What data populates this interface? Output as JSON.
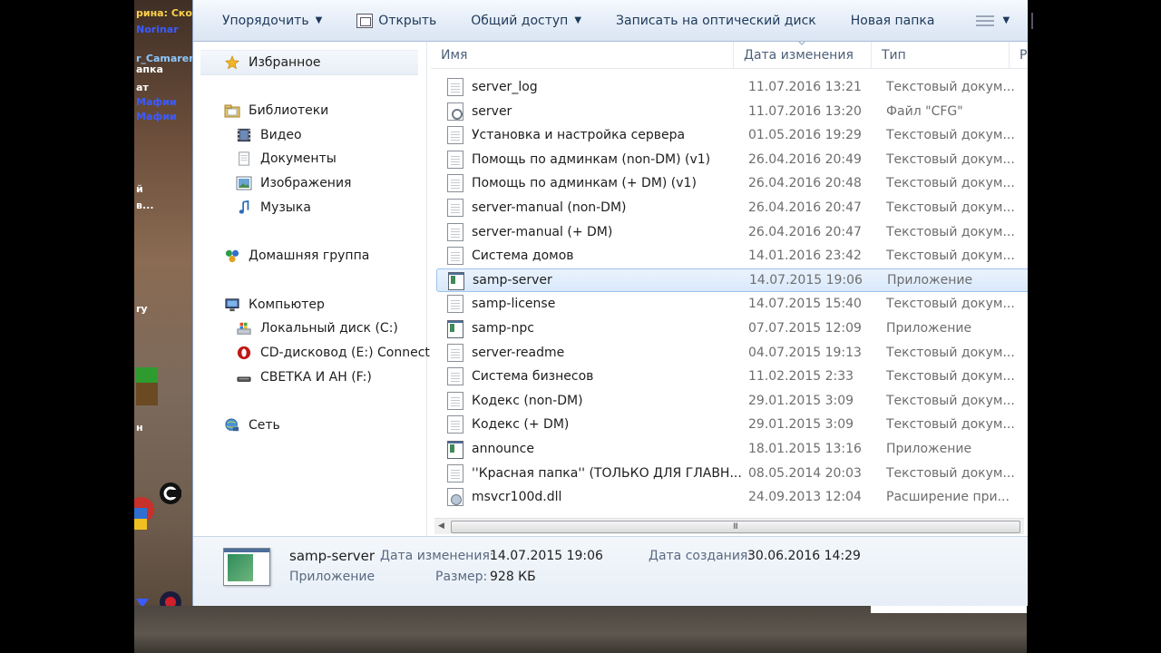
{
  "game_chat": [
    "рина: Ско",
    "Norinar",
    "r_Camaren",
    "апка",
    "ат",
    "Мафии",
    "Мафии",
    "й",
    "в...",
    "ry",
    "н"
  ],
  "toolbar": {
    "organize": "Упорядочить",
    "open": "Открыть",
    "share": "Общий доступ",
    "burn": "Записать на оптический диск",
    "new_folder": "Новая папка"
  },
  "nav": {
    "favorites": "Избранное",
    "libraries": "Библиотеки",
    "video": "Видео",
    "documents": "Документы",
    "images": "Изображения",
    "music": "Музыка",
    "homegroup": "Домашняя группа",
    "computer": "Компьютер",
    "local_disk": "Локальный диск (C:)",
    "cd_drive": "CD-дисковод (E:) Connect",
    "usb_drive": "СВЕТКА И АН (F:)",
    "network": "Сеть"
  },
  "columns": {
    "name": "Имя",
    "date": "Дата изменения",
    "type": "Тип",
    "size_partial": "Р"
  },
  "files": [
    {
      "icon": "doc",
      "name": "server_log",
      "date": "11.07.2016 13:21",
      "type": "Текстовый докум..."
    },
    {
      "icon": "cfg",
      "name": "server",
      "date": "11.07.2016 13:20",
      "type": "Файл \"CFG\""
    },
    {
      "icon": "doc",
      "name": "Установка и настройка сервера",
      "date": "01.05.2016 19:29",
      "type": "Текстовый докум..."
    },
    {
      "icon": "doc",
      "name": "Помощь по админкам (non-DM) (v1)",
      "date": "26.04.2016 20:49",
      "type": "Текстовый докум..."
    },
    {
      "icon": "doc",
      "name": "Помощь по админкам (+ DM) (v1)",
      "date": "26.04.2016 20:48",
      "type": "Текстовый докум..."
    },
    {
      "icon": "doc",
      "name": "server-manual (non-DM)",
      "date": "26.04.2016 20:47",
      "type": "Текстовый докум..."
    },
    {
      "icon": "doc",
      "name": "server-manual (+ DM)",
      "date": "26.04.2016 20:47",
      "type": "Текстовый докум..."
    },
    {
      "icon": "doc",
      "name": "Система домов",
      "date": "14.01.2016 23:42",
      "type": "Текстовый докум..."
    },
    {
      "icon": "app",
      "name": "samp-server",
      "date": "14.07.2015 19:06",
      "type": "Приложение",
      "selected": true
    },
    {
      "icon": "doc",
      "name": "samp-license",
      "date": "14.07.2015 15:40",
      "type": "Текстовый докум..."
    },
    {
      "icon": "app",
      "name": "samp-npc",
      "date": "07.07.2015 12:09",
      "type": "Приложение"
    },
    {
      "icon": "doc",
      "name": "server-readme",
      "date": "04.07.2015 19:13",
      "type": "Текстовый докум..."
    },
    {
      "icon": "doc",
      "name": "Система бизнесов",
      "date": "11.02.2015 2:33",
      "type": "Текстовый докум..."
    },
    {
      "icon": "doc",
      "name": "Кодекс (non-DM)",
      "date": "29.01.2015 3:09",
      "type": "Текстовый докум..."
    },
    {
      "icon": "doc",
      "name": "Кодекс (+ DM)",
      "date": "29.01.2015 3:09",
      "type": "Текстовый докум..."
    },
    {
      "icon": "app",
      "name": "announce",
      "date": "18.01.2015 13:16",
      "type": "Приложение"
    },
    {
      "icon": "doc",
      "name": "''Красная папка'' (ТОЛЬКО ДЛЯ ГЛАВН...",
      "date": "08.05.2014 20:03",
      "type": "Текстовый докум..."
    },
    {
      "icon": "dll",
      "name": "msvcr100d.dll",
      "date": "24.09.2013 12:04",
      "type": "Расширение при..."
    }
  ],
  "scrollbar": {
    "grip": "III"
  },
  "details": {
    "name": "samp-server",
    "kind": "Приложение",
    "modified_label": "Дата изменения:",
    "modified_value": "14.07.2015 19:06",
    "size_label": "Размер:",
    "size_value": "928 КБ",
    "created_label": "Дата создания:",
    "created_value": "30.06.2016 14:29"
  },
  "colors": {
    "toolbar_text": "#1e395b",
    "selection_border": "#9cc3ee",
    "secondary_text": "#6d6d6d"
  }
}
